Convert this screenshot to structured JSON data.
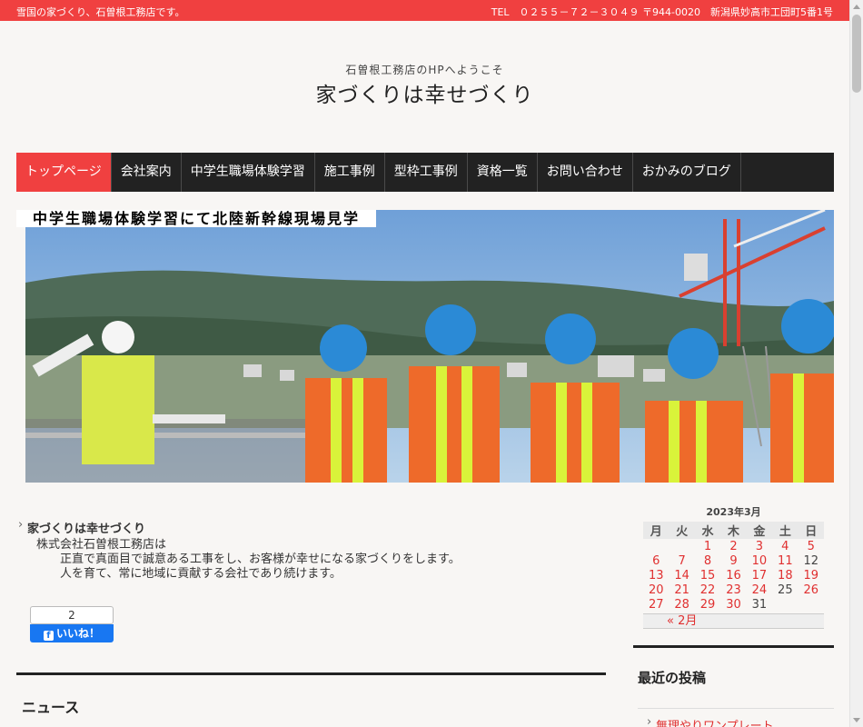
{
  "topbar": {
    "tagline": "雪国の家づくり、石曽根工務店です。",
    "contact": "TEL　０２５５－７２－３０４９ 〒944-0020　新潟県妙高市工団町5番1号"
  },
  "branding": {
    "subtitle": "石曽根工務店のHPへようこそ",
    "title": "家づくりは幸せづくり"
  },
  "nav": {
    "items": [
      "トップページ",
      "会社案内",
      "中学生職場体験学習",
      "施工事例",
      "型枠工事例",
      "資格一覧",
      "お問い合わせ",
      "おかみのブログ"
    ]
  },
  "hero": {
    "caption": "中学生職場体験学習にて北陸新幹線現場見学"
  },
  "content": {
    "intro_title": "家づくりは幸せづくり",
    "line1": "株式会社石曽根工務店は",
    "line2": "正直で真面目で誠意ある工事をし、お客様が幸せになる家づくりをします。",
    "line3": "人を育て、常に地域に貢献する会社であり続けます。"
  },
  "facebook": {
    "count": "2",
    "like_label": "いいね！"
  },
  "news": {
    "title": "ニュース"
  },
  "calendar": {
    "caption": "2023年3月",
    "weekdays": [
      "月",
      "火",
      "水",
      "木",
      "金",
      "土",
      "日"
    ],
    "rows": [
      [
        "",
        "",
        "1",
        "2",
        "3",
        "4",
        "5"
      ],
      [
        "6",
        "7",
        "8",
        "9",
        "10",
        "11",
        "12"
      ],
      [
        "13",
        "14",
        "15",
        "16",
        "17",
        "18",
        "19"
      ],
      [
        "20",
        "21",
        "22",
        "23",
        "24",
        "25",
        "26"
      ],
      [
        "27",
        "28",
        "29",
        "30",
        "31",
        "",
        ""
      ]
    ],
    "plain_days": [
      "12",
      "25",
      "31"
    ],
    "prev_link": "« 2月"
  },
  "sidebar": {
    "recent_title": "最近の投稿",
    "recent_post": "無理やりワンプレート"
  },
  "colors": {
    "accent": "#f04040",
    "nav_bg": "#222222"
  }
}
